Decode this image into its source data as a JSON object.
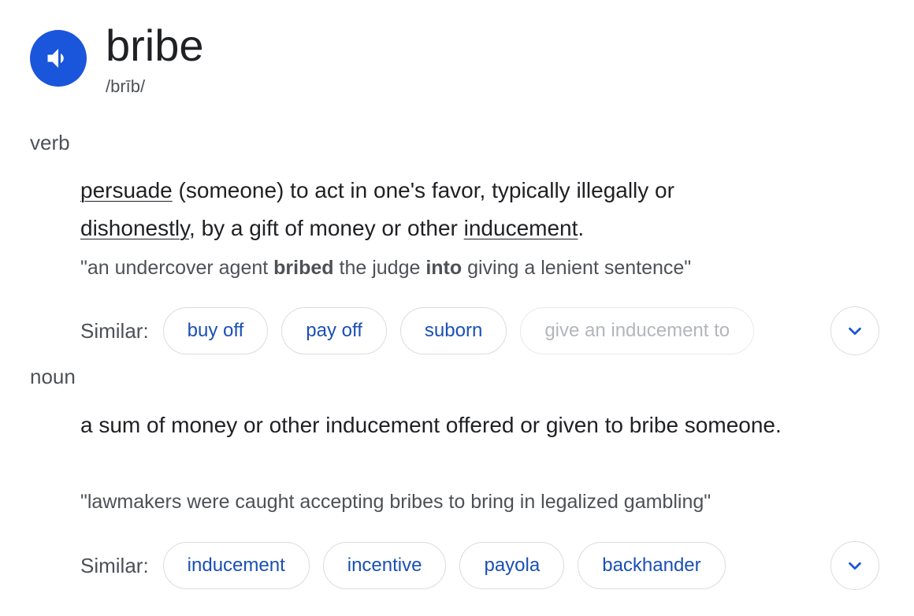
{
  "entry": {
    "word": "bribe",
    "phonetic": "/brīb/"
  },
  "verb": {
    "pos": "verb",
    "definition": {
      "w1": "persuade",
      "t1": " (someone) to act in one's favor, typically illegally or ",
      "w2": "dishonestly",
      "t2": ", by a gift of money or other ",
      "w3": "inducement",
      "t3": "."
    },
    "example": {
      "p1": "\"an undercover agent ",
      "b1": "bribed",
      "p2": " the judge ",
      "b2": "into",
      "p3": " giving a lenient sentence\""
    },
    "similar_label": "Similar:",
    "similar": [
      "buy off",
      "pay off",
      "suborn",
      "give an inducement to"
    ]
  },
  "noun": {
    "pos": "noun",
    "definition": "a sum of money or other inducement offered or given to bribe someone.",
    "example": "\"lawmakers were caught accepting bribes to bring in legalized gambling\"",
    "similar_label": "Similar:",
    "similar": [
      "inducement",
      "incentive",
      "payola",
      "backhander"
    ]
  },
  "icons": {
    "speaker": "speaker-icon",
    "expand": "chevron-down-icon"
  },
  "colors": {
    "accent": "#1a56db",
    "chip_text": "#1a4fb5",
    "faded_chip_text": "#b3b6ba"
  }
}
